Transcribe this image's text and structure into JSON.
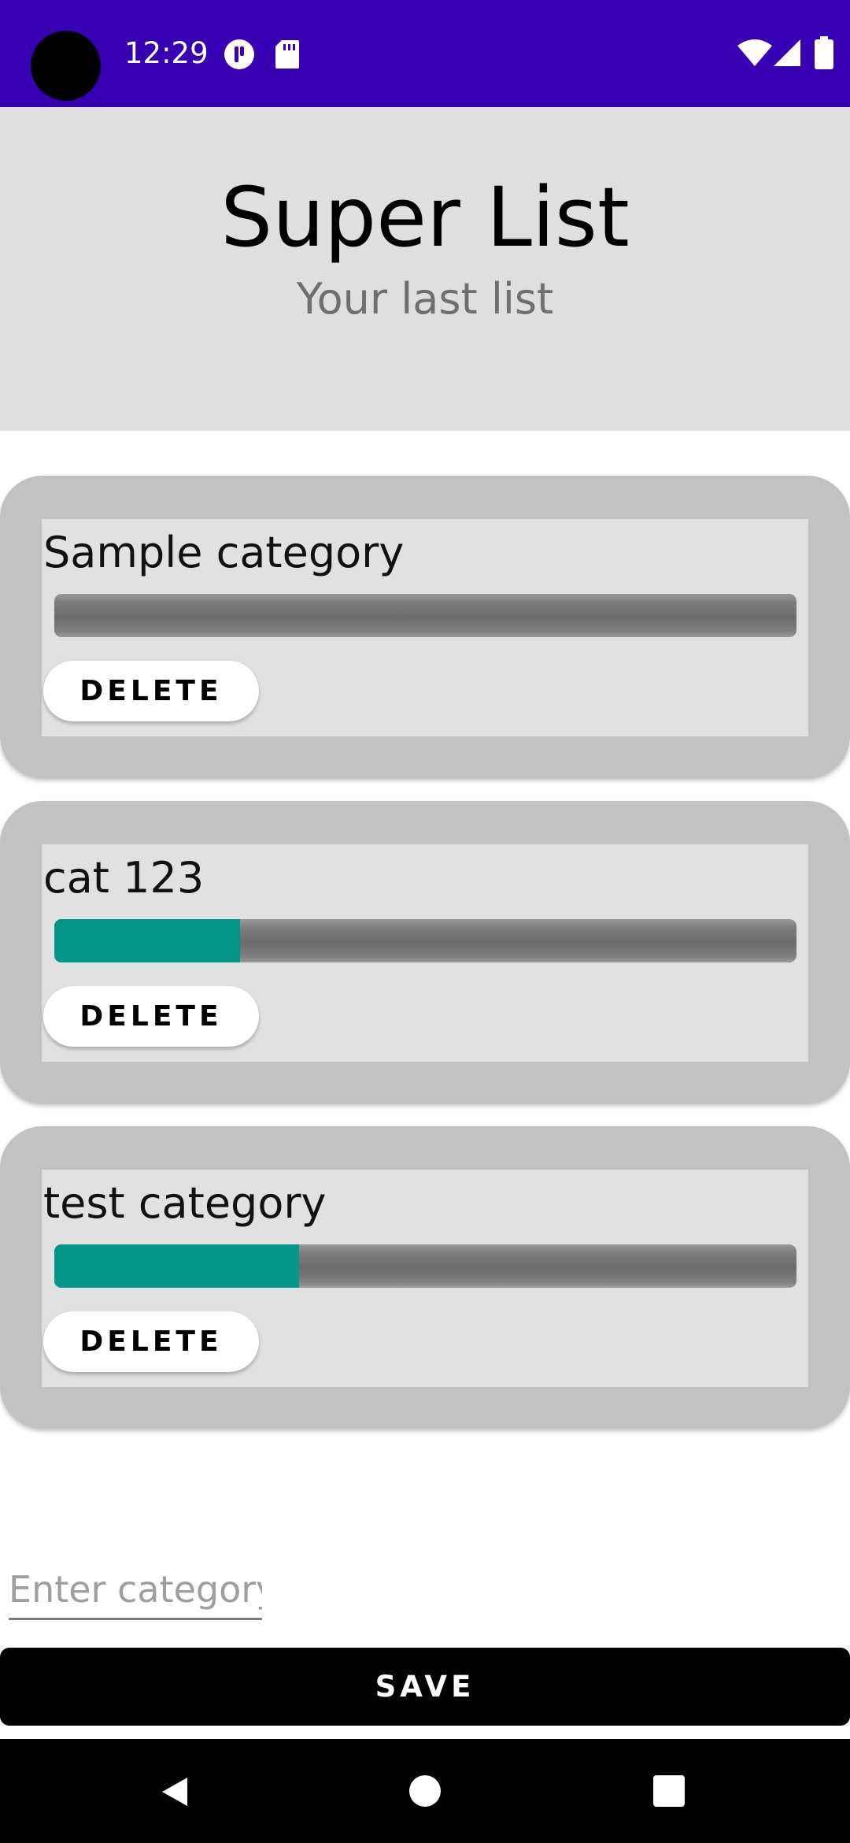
{
  "status_bar": {
    "time": "12:29",
    "icons": [
      "camera-dot",
      "shield-notification-icon",
      "sd-card-icon",
      "wifi-icon",
      "signal-icon",
      "battery-icon"
    ]
  },
  "header": {
    "title": "Super List",
    "subtitle": "Your last list"
  },
  "categories": [
    {
      "name": "Sample category",
      "progress": 0.0,
      "delete_label": "DELETE"
    },
    {
      "name": "cat 123",
      "progress": 0.25,
      "delete_label": "DELETE"
    },
    {
      "name": "test category",
      "progress": 0.33,
      "delete_label": "DELETE"
    }
  ],
  "input": {
    "placeholder": "Enter category",
    "value": ""
  },
  "save_label": "SAVE",
  "nav": {
    "icons": [
      "back-icon",
      "home-icon",
      "recents-icon"
    ]
  },
  "colors": {
    "status_bar": "#3700B3",
    "header_bg": "#dfdfdf",
    "progress_fill": "#009688",
    "card_outer": "#c2c2c2",
    "card_inner": "#e1e1e1"
  }
}
